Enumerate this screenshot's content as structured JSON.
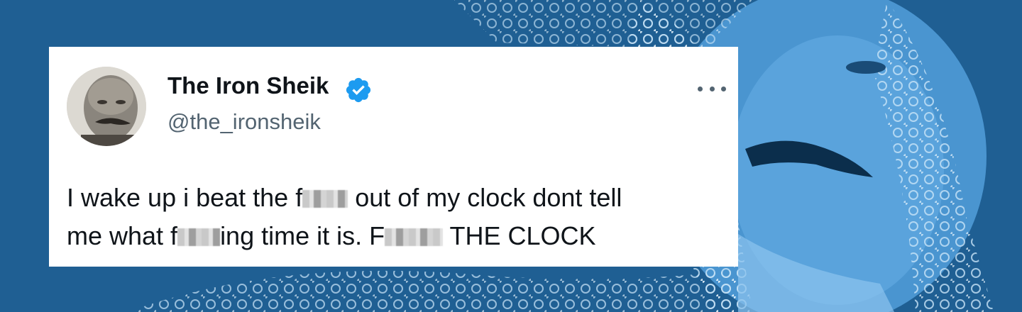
{
  "background": {
    "color": "#1f5f93",
    "tone": "#4a95d0",
    "highlight": "#8cc3ee"
  },
  "tweet": {
    "display_name": "The Iron Sheik",
    "handle": "@the_ironsheik",
    "verified": true,
    "verified_color": "#1d9bf0",
    "more_icon": "more-horizontal-icon",
    "text_line1": {
      "before_censor": "I wake up i beat the f",
      "after_censor": "out of my clock dont tell"
    },
    "text_line2": {
      "before_censor1": "me what f",
      "after_censor1": "ing time it is. F",
      "after_censor2": "THE CLOCK"
    }
  }
}
